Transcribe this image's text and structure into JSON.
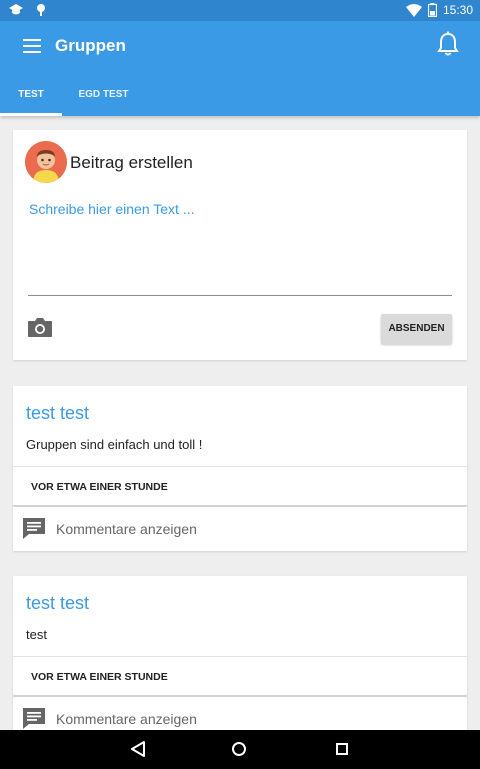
{
  "statusbar": {
    "time": "15:30"
  },
  "appbar": {
    "title": "Gruppen"
  },
  "tabs": [
    {
      "label": "TEST",
      "active": true
    },
    {
      "label": "EGD TEST",
      "active": false
    }
  ],
  "composer": {
    "title": "Beitrag erstellen",
    "input_placeholder": "Schreibe hier einen Text ...",
    "send_label": "ABSENDEN"
  },
  "posts": [
    {
      "author": "test test",
      "body": "Gruppen sind einfach und toll !",
      "time": "VOR ETWA EINER STUNDE",
      "comments_label": "Kommentare anzeigen"
    },
    {
      "author": "test test",
      "body": "test",
      "time": "VOR ETWA EINER STUNDE",
      "comments_label": "Kommentare anzeigen"
    }
  ],
  "colors": {
    "primary": "#3b9ae6",
    "statusbar": "#2f86cf",
    "background": "#eeeeee",
    "card": "#ffffff",
    "send_button": "#dadada"
  },
  "icons": [
    "school-icon",
    "pin-icon",
    "wifi-icon",
    "battery-icon",
    "menu-icon",
    "bell-icon",
    "avatar",
    "camera-icon",
    "comment-icon",
    "back-icon",
    "home-icon",
    "recents-icon"
  ]
}
